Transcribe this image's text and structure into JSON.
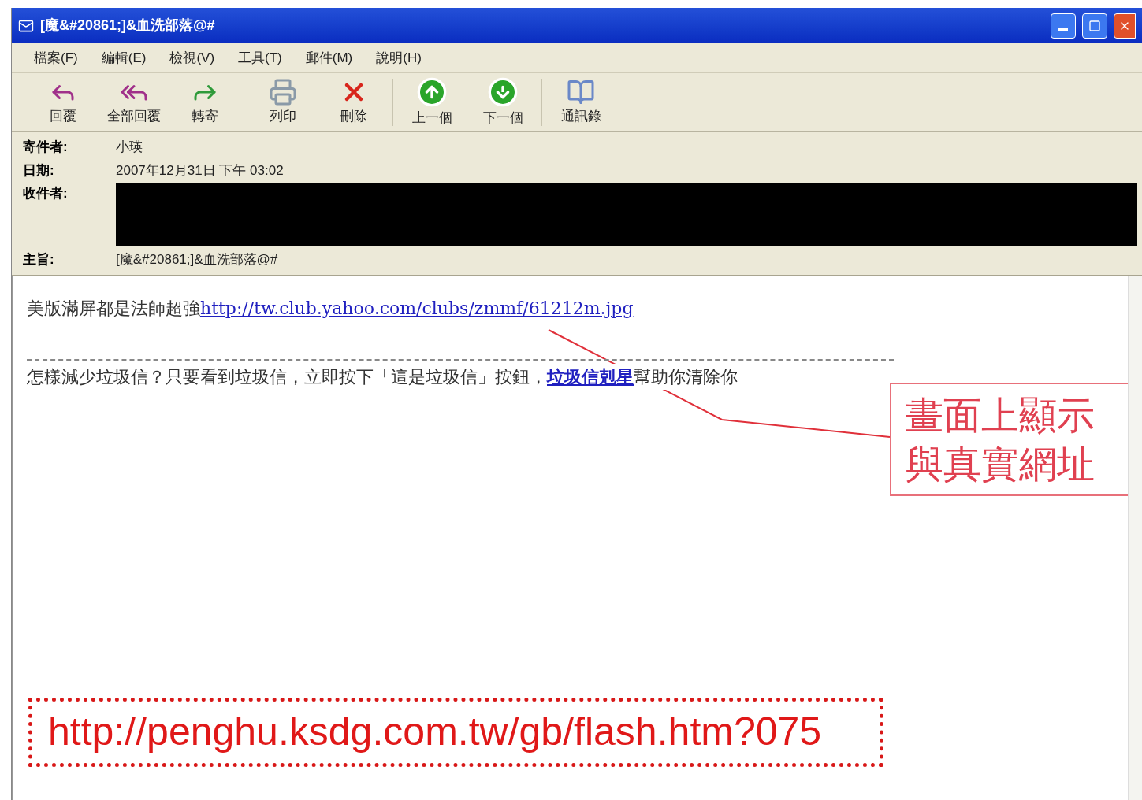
{
  "window": {
    "title": "[魔&#20861;]&血洗部落@#"
  },
  "menu": [
    "檔案(F)",
    "編輯(E)",
    "檢視(V)",
    "工具(T)",
    "郵件(M)",
    "說明(H)"
  ],
  "toolbar": [
    {
      "kind": "reply",
      "label": "回覆"
    },
    {
      "kind": "reply_all",
      "label": "全部回覆"
    },
    {
      "kind": "forward",
      "label": "轉寄"
    },
    {
      "kind": "print",
      "label": "列印"
    },
    {
      "kind": "delete",
      "label": "刪除"
    },
    {
      "kind": "previous",
      "label": "上一個"
    },
    {
      "kind": "next",
      "label": "下一個"
    },
    {
      "kind": "contacts",
      "label": "通訊錄"
    }
  ],
  "header": {
    "from_label": "寄件者:",
    "from": "小瑛",
    "date_label": "日期:",
    "date": "2007年12月31日 下午 03:02",
    "to_label": "收件者:",
    "to_redacted": true,
    "subject_label": "主旨:",
    "subject": "[魔&#20861;]&血洗部落@#"
  },
  "body": {
    "line_text": "美版滿屏都是法師超強",
    "line_link": "http://tw.club.yahoo.com/clubs/zmmf/61212m.jpg",
    "spam_text": "怎樣減少垃圾信？只要看到垃圾信，立即按下「這是垃圾信」按鈕，",
    "spam_link": "垃圾信剋星",
    "spam_tail": "幫助你清除你"
  },
  "callout": {
    "lines": [
      "畫面上顯示",
      "與真實網址"
    ]
  },
  "real_url": "http://penghu.ksdg.com.tw/gb/flash.htm?075"
}
